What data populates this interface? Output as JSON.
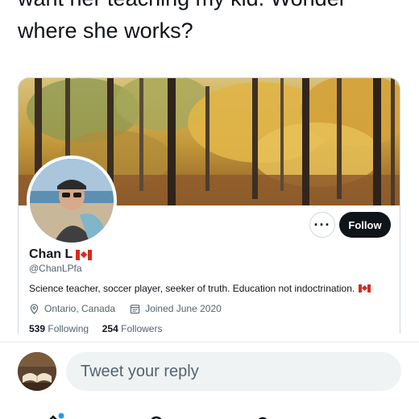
{
  "tweet": {
    "line1": "want her teaching my kid. Wonder",
    "line2": "where she works?"
  },
  "profile": {
    "name": "Chan L",
    "handle": "@ChanLPfa",
    "bio": "Science teacher, soccer player, seeker of truth. Education not indoctrination.",
    "location": "Ontario, Canada",
    "joined": "Joined June 2020",
    "following_count": "539",
    "following_label": "Following",
    "followers_count": "254",
    "followers_label": "Followers",
    "follow_label": "Follow",
    "more_label": "···"
  },
  "reply": {
    "placeholder": "Tweet your reply"
  },
  "colors": {
    "text": "#0f1419",
    "secondary": "#536471",
    "follow_bg": "#0f1419",
    "input_bg": "#eff3f4",
    "accent": "#1d9bf0"
  },
  "icons": [
    "location-icon",
    "calendar-icon",
    "more-icon",
    "canada-flag-icon",
    "home-icon",
    "search-icon",
    "spaces-icon",
    "notifications-icon",
    "messages-icon"
  ]
}
